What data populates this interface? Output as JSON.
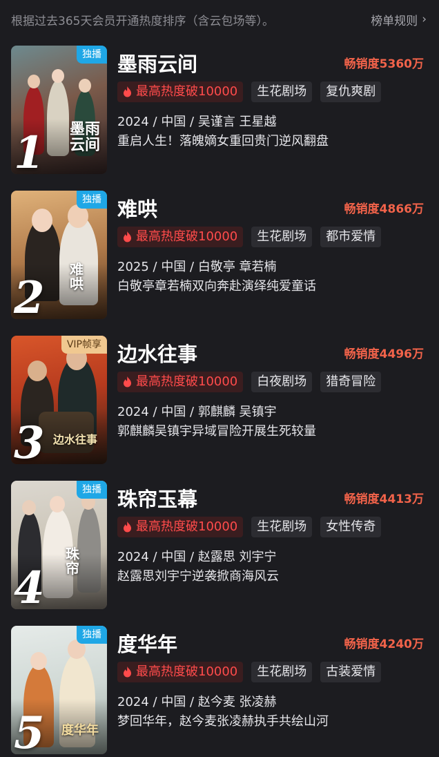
{
  "header": {
    "description": "根据过去365天会员开通热度排序（含云包场等）。",
    "rules_label": "榜单规则"
  },
  "colors": {
    "background": "#1c1c20",
    "sales_red": "#f2634a",
    "hot_red": "#ff4b4b",
    "exclusive_blue": "#1fa7e6",
    "vip_gold": "#f0c890"
  },
  "items": [
    {
      "rank": "1",
      "badge": "独播",
      "title": "墨雨云间",
      "poster_title": "墨雨\n云间",
      "sales": "畅销度5360万",
      "hot_tag": "最高热度破10000",
      "tags": [
        "生花剧场",
        "复仇爽剧"
      ],
      "meta": "2024 / 中国 / 吴谨言 王星越",
      "synopsis": "重启人生！落魄嫡女重回贵门逆风翻盘"
    },
    {
      "rank": "2",
      "badge": "独播",
      "title": "难哄",
      "poster_title": "难\n哄",
      "sales": "畅销度4866万",
      "hot_tag": "最高热度破10000",
      "tags": [
        "生花剧场",
        "都市爱情"
      ],
      "meta": "2025 / 中国 / 白敬亭 章若楠",
      "synopsis": "白敬亭章若楠双向奔赴演绎纯爱童话"
    },
    {
      "rank": "3",
      "badge": "VIP帧享",
      "title": "边水往事",
      "poster_title": "边水往事",
      "sales": "畅销度4496万",
      "hot_tag": "最高热度破10000",
      "tags": [
        "白夜剧场",
        "猎奇冒险"
      ],
      "meta": "2024 / 中国 / 郭麒麟 吴镇宇",
      "synopsis": "郭麒麟吴镇宇异域冒险开展生死较量"
    },
    {
      "rank": "4",
      "badge": "独播",
      "title": "珠帘玉幕",
      "poster_title": "珠\n帘",
      "sales": "畅销度4413万",
      "hot_tag": "最高热度破10000",
      "tags": [
        "生花剧场",
        "女性传奇"
      ],
      "meta": "2024 / 中国 / 赵露思 刘宇宁",
      "synopsis": "赵露思刘宇宁逆袭掀商海风云"
    },
    {
      "rank": "5",
      "badge": "独播",
      "title": "度华年",
      "poster_title": "度华年",
      "sales": "畅销度4240万",
      "hot_tag": "最高热度破10000",
      "tags": [
        "生花剧场",
        "古装爱情"
      ],
      "meta": "2024 / 中国 / 赵今麦 张凌赫",
      "synopsis": "梦回华年，赵今麦张凌赫执手共绘山河"
    }
  ]
}
